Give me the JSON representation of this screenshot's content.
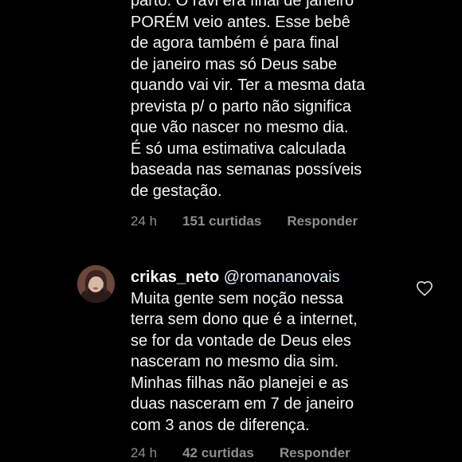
{
  "comments": [
    {
      "text_lines": "parto. O ravi era final de janeiro\nPORÉM veio antes. Esse bebê\nde agora também é para final\nde janeiro mas só Deus sabe\nquando vai vir. Ter a mesma data\nprevista p/ o parto não significa\nque vão nascer no mesmo dia.\nÉ só uma estimativa calculada\nbaseada nas semanas possíveis\nde gestação.",
      "time": "24 h",
      "likes": "151 curtidas",
      "reply_label": "Responder"
    },
    {
      "username": "crikas_neto",
      "mention": "@romananovais",
      "text_first_line_tail": "",
      "text_rest": "Muita gente sem noção nessa\nterra sem dono que é a internet,\nse for da vontade de Deus eles\nnasceram no mesmo dia sim.\nMinhas filhas não planejei e as\nduas nasceram em 7 de janeiro\ncom 3 anos de diferença.",
      "time": "24 h",
      "likes": "42 curtidas",
      "reply_label": "Responder",
      "like_icon": "heart-outline-icon"
    }
  ],
  "colors": {
    "background": "#000000",
    "text": "#f5f5f5",
    "meta": "#8e8e8e"
  }
}
